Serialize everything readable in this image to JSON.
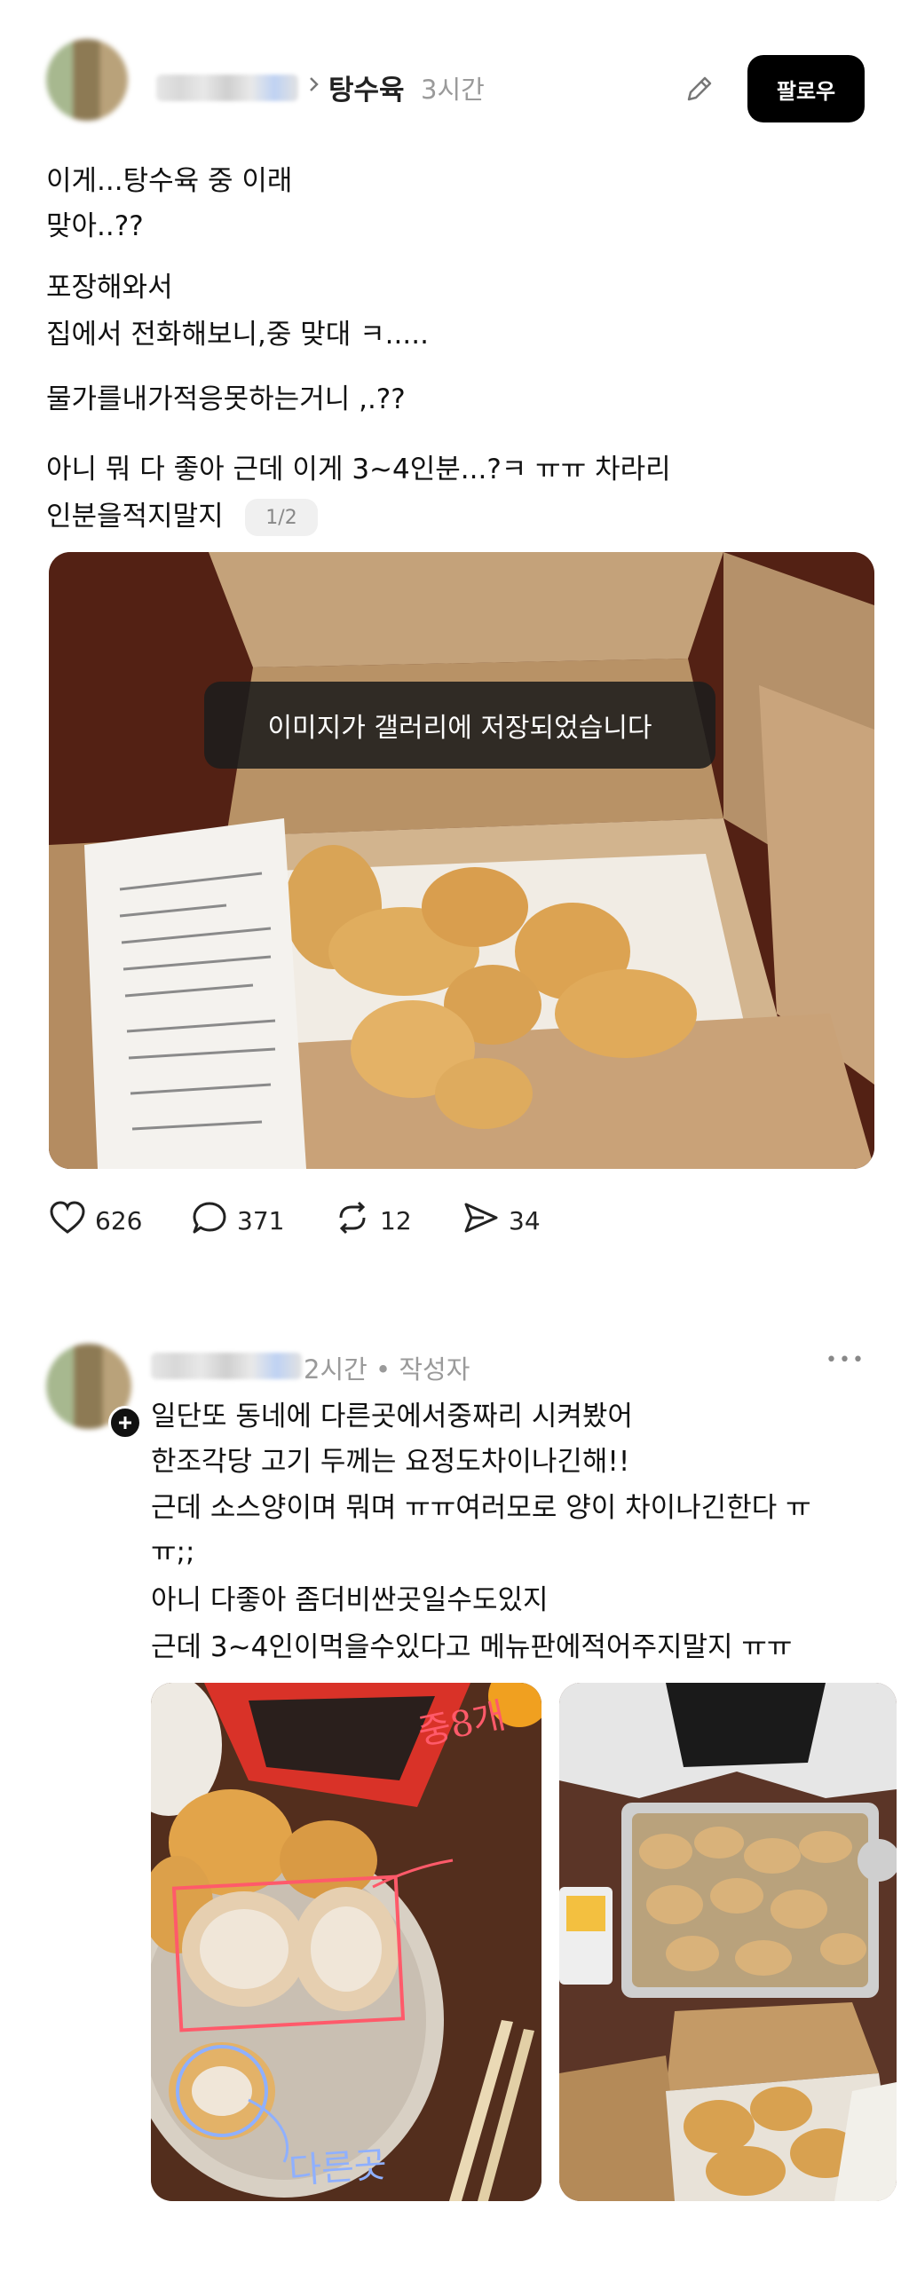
{
  "post": {
    "category": "탕수육",
    "time": "3시간",
    "follow_label": "팔로우",
    "lines": [
      "이게...탕수육 중 이래",
      "맞아..??",
      "포장해와서",
      "집에서 전화해보니,중 맞대 ㅋ.....",
      "물가를내가적응못하는거니 ,.??",
      "아니 뭐 다 좋아 근데 이게 3~4인분...?ㅋ ㅠㅠ 차라리",
      "인분을적지말지"
    ],
    "pager": "1/2",
    "toast": "이미지가 갤러리에 저장되었습니다",
    "stats": {
      "likes": "626",
      "comments": "371",
      "reposts": "12",
      "shares": "34"
    }
  },
  "reply": {
    "time": "2시간 • 작성자",
    "more_label": "•••",
    "lines": [
      "일단또 동네에 다른곳에서중짜리 시켜봤어",
      "한조각당 고기 두께는 요정도차이나긴해!!",
      "근데 소스양이며 뭐며 ㅠㅠ여러모로 양이 차이나긴한다 ㅠ",
      "ㅠ;;",
      "아니 다좋아 좀더비싼곳일수도있지",
      "근데 3~4인이먹을수있다고 메뉴판에적어주지말지 ㅠㅠ"
    ],
    "handwriting": [
      "중8개",
      "다른곳"
    ]
  },
  "icons": {
    "chevron": "chevron-right-icon",
    "edit": "pencil-icon",
    "like": "heart-icon",
    "comment": "comment-icon",
    "repost": "repost-icon",
    "share": "send-icon",
    "more": "more-icon",
    "add": "plus-icon"
  }
}
